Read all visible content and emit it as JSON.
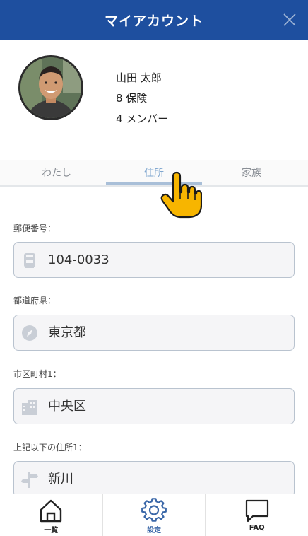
{
  "header": {
    "title": "マイアカウント"
  },
  "profile": {
    "name": "山田 太郎",
    "insurance_count": "8 保険",
    "member_count": "4 メンバー"
  },
  "tabs": [
    {
      "label": "わたし",
      "active": false
    },
    {
      "label": "住所",
      "active": true
    },
    {
      "label": "家族",
      "active": false
    }
  ],
  "form": {
    "postal": {
      "label": "郵便番号：",
      "value": "104-0033",
      "icon": "mailbox-icon"
    },
    "prefecture": {
      "label": "都道府県：",
      "value": "東京都",
      "icon": "compass-icon"
    },
    "city": {
      "label": "市区町村1：",
      "value": "中央区",
      "icon": "buildings-icon"
    },
    "address": {
      "label": "上記以下の住所1：",
      "value": "新川",
      "icon": "signpost-icon"
    }
  },
  "nav": [
    {
      "label": "一覧",
      "icon": "home-icon",
      "active": false
    },
    {
      "label": "設定",
      "icon": "gear-icon",
      "active": true
    },
    {
      "label": "FAQ",
      "icon": "chat-bubble-icon",
      "active": false
    }
  ],
  "colors": {
    "header": "#1e4f9f",
    "active_tab": "#7fa6cf",
    "active_nav": "#3a67a8",
    "pointer": "#f7b500"
  }
}
